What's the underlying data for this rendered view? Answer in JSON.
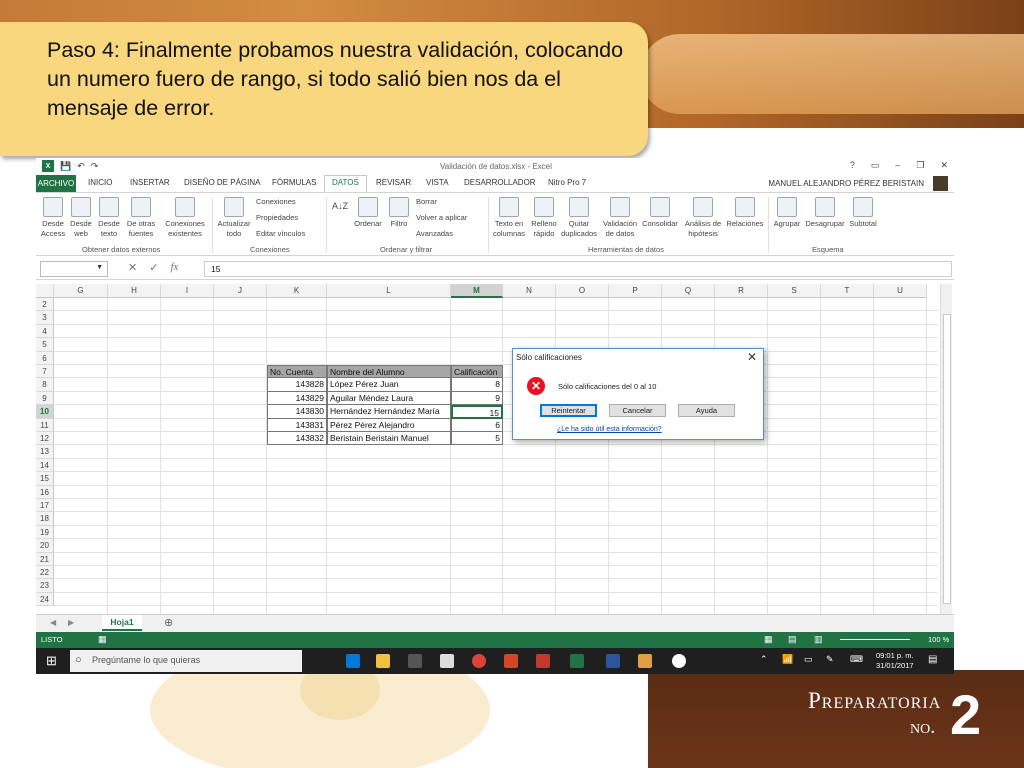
{
  "slide": {
    "instruction": "Paso 4: Finalmente probamos nuestra validación, colocando un numero fuero de rango, si todo salió bien nos da el mensaje de error.",
    "brand_word": "Preparatoria",
    "brand_no": "no.",
    "brand_num": "2"
  },
  "excel": {
    "window_title": "Validación de datos.xlsx - Excel",
    "user_name": "MANUEL ALEJANDRO PÉREZ BERISTAIN",
    "tabs": [
      "ARCHIVO",
      "INICIO",
      "INSERTAR",
      "DISEÑO DE PÁGINA",
      "FÓRMULAS",
      "DATOS",
      "REVISAR",
      "VISTA",
      "DESARROLLADOR",
      "Nitro Pro 7"
    ],
    "active_tab": "DATOS",
    "ribbon": {
      "btn_access": "Desde Access",
      "btn_web": "Desde web",
      "btn_text": "Desde texto",
      "btn_other": "De otras fuentes",
      "btn_existing": "Conexiones existentes",
      "btn_refresh": "Actualizar todo",
      "sm_connections": "Conexiones",
      "sm_properties": "Propiedades",
      "sm_editlinks": "Editar vínculos",
      "btn_sort": "Ordenar",
      "btn_filter": "Filtro",
      "sm_clear": "Borrar",
      "sm_reapply": "Volver a aplicar",
      "sm_advanced": "Avanzadas",
      "btn_text_cols": "Texto en columnas",
      "btn_flash": "Relleno rápido",
      "btn_dupes": "Quitar duplicados",
      "btn_validation": "Validación de datos",
      "btn_consolidate": "Consolidar",
      "btn_whatif": "Análisis de hipótesis",
      "btn_relations": "Relaciones",
      "btn_group": "Agrupar",
      "btn_ungroup": "Desagrupar",
      "btn_subtotal": "Subtotal",
      "grp_external": "Obtener datos externos",
      "grp_connections": "Conexiones",
      "grp_sort": "Ordenar y filtrar",
      "grp_tools": "Herramientas de datos",
      "grp_outline": "Esquema"
    },
    "formula_value": "15",
    "columns": [
      "G",
      "H",
      "I",
      "J",
      "K",
      "L",
      "M",
      "N",
      "O",
      "P",
      "Q",
      "R",
      "S",
      "T",
      "U"
    ],
    "selected_column": "M",
    "rows": [
      "2",
      "3",
      "4",
      "5",
      "6",
      "7",
      "8",
      "9",
      "10",
      "11",
      "12",
      "13",
      "14",
      "15",
      "16",
      "17",
      "18",
      "19",
      "20",
      "21",
      "22",
      "23",
      "24"
    ],
    "selected_row": "10",
    "table": {
      "headers": [
        "No. Cuenta",
        "Nombre del Alumno",
        "Calificación"
      ],
      "records": [
        {
          "cuenta": "143828",
          "nombre": "López Pérez Juan",
          "calif": "8"
        },
        {
          "cuenta": "143829",
          "nombre": "Aguilar Méndez Laura",
          "calif": "9"
        },
        {
          "cuenta": "143830",
          "nombre": "Hernández Hernández María",
          "calif": "15"
        },
        {
          "cuenta": "143831",
          "nombre": "Pérez Pérez Alejandro",
          "calif": "6"
        },
        {
          "cuenta": "143832",
          "nombre": "Beristain Beristain Manuel",
          "calif": "5"
        }
      ]
    },
    "dialog": {
      "title": "Sólo calificaciones",
      "message": "Sólo calificaciones del 0 al 10",
      "retry": "Reintentar",
      "cancel": "Cancelar",
      "help": "Ayuda",
      "link": "¿Le ha sido útil esta información?"
    },
    "sheet_tab": "Hoja1",
    "status_ready": "LISTO",
    "zoom": "100 %",
    "taskbar": {
      "search_placeholder": "Pregúntame lo que quieras",
      "time": "09:01 p. m.",
      "date": "31/01/2017"
    },
    "colors": {
      "excel_green": "#217346",
      "error_red": "#e81123"
    }
  }
}
